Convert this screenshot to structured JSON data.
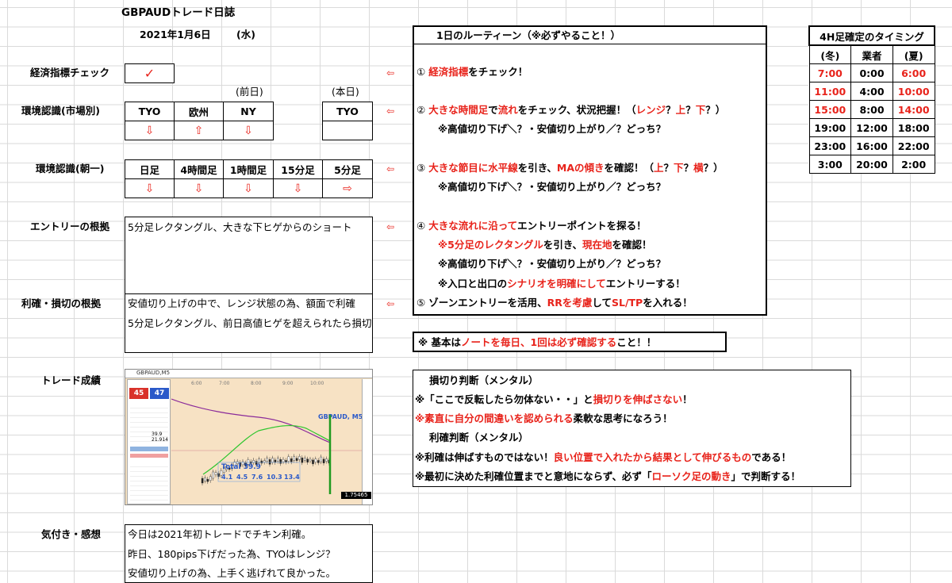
{
  "header": {
    "title": "GBPAUDトレード日誌",
    "date": "2021年1月6日",
    "weekday": "(水)"
  },
  "labels": {
    "indicator_check": "経済指標チェック",
    "env_market": "環境認識(市場別)",
    "env_morning": "環境認識(朝一)",
    "entry_basis": "エントリーの根拠",
    "tp_sl_basis": "利確・損切の根拠",
    "result": "トレード成績",
    "notes": "気付き・感想"
  },
  "indicator_check": {
    "mark": "✓"
  },
  "market_env": {
    "prev_day": "(前日)",
    "today": "(本日)",
    "cols": [
      "TYO",
      "欧州",
      "NY"
    ],
    "arrows": [
      "⇩",
      "⇧",
      "⇩"
    ],
    "today_col": "TYO"
  },
  "morning_env": {
    "cols": [
      "日足",
      "4時間足",
      "1時間足",
      "15分足",
      "5分足"
    ],
    "arrows": [
      "⇩",
      "⇩",
      "⇩",
      "⇩",
      "⇨"
    ]
  },
  "entry": {
    "text": "5分足レクタングル、大きな下ヒゲからのショート"
  },
  "tpsl": {
    "line1": "安値切り上げの中で、レンジ状態の為、額面で利確",
    "line2": "5分足レクタングル、前日高値ヒゲを超えられたら損切"
  },
  "notes": {
    "line1": "今日は2021年初トレードでチキン利確。",
    "line2": "昨日、180pips下げだった為、TYOはレンジ？",
    "line3": "安値切り上げの為、上手く逃げれて良かった。"
  },
  "left_arrow": "⇦",
  "routine": {
    "title": "1日のルーティーン（※必ずやること！）",
    "r1_num": "①",
    "r1_a": "経済指標",
    "r1_b": "をチェック！",
    "r2_num": "②",
    "r2_a": "大きな時間足",
    "r2_b": "で",
    "r2_c": "流れ",
    "r2_d": "をチェック、状況把握！（",
    "r2_e": "レンジ",
    "r2_f": "？",
    "r2_g": "上",
    "r2_h": "？",
    "r2_i": "下",
    "r2_j": "？）",
    "r2_sub": "※高値切り下げ＼？・安値切り上がり／？どっち？",
    "r3_num": "③",
    "r3_a": "大きな節目に",
    "r3_b": "水平線",
    "r3_c": "を引き、",
    "r3_d": "MAの傾き",
    "r3_e": "を確認！（",
    "r3_f": "上",
    "r3_g": "？",
    "r3_h": "下",
    "r3_i": "？",
    "r3_j": "横",
    "r3_k": "？）",
    "r3_sub": "※高値切り下げ＼？・安値切り上がり／？どっち？",
    "r4_num": "④",
    "r4_a": "大きな流れに沿って",
    "r4_b": "エントリーポイントを探る！",
    "r4_s1a": "※5分足のレクタングル",
    "r4_s1b": "を引き、",
    "r4_s1c": "現在地",
    "r4_s1d": "を確認！",
    "r4_s2": "※高値切り下げ＼？・安値切り上がり／？どっち？",
    "r4_s3a": "※入口と出口の",
    "r4_s3b": "シナリオを明確にして",
    "r4_s3c": "エントリーする！",
    "r5_num": "⑤",
    "r5_a": "ゾーンエントリーを活用、",
    "r5_b": "RRを考慮",
    "r5_c": "して",
    "r5_d": "SL/TP",
    "r5_e": "を入れる！"
  },
  "note_box": {
    "a": "※ 基本は",
    "b": "ノートを毎日、1回は必ず確認する",
    "c": "こと！！"
  },
  "mental": {
    "sl_title": "損切り判断（メンタル）",
    "sl1_a": "※「ここで反転したら勿体ない・・」と",
    "sl1_b": "損切りを伸ばさない",
    "sl1_c": "！",
    "sl2_a": "※素直に自分の間違いを認められる",
    "sl2_b": "柔軟な思考になろう！",
    "tp_title": "利確判断（メンタル）",
    "tp1_a": "※利確は伸ばすものではない！",
    "tp1_b": "良い位置で入れたから結果として伸びるもの",
    "tp1_c": "である！",
    "tp2_a": "※最初に決めた利確位置までと意地にならず、必ず「",
    "tp2_b": "ローソク足の動き",
    "tp2_c": "」で判断する！"
  },
  "timing": {
    "title": "4H足確定のタイミング",
    "headers": [
      "(冬)",
      "業者",
      "(夏)"
    ],
    "rows": [
      [
        "7:00",
        "0:00",
        "6:00"
      ],
      [
        "11:00",
        "4:00",
        "10:00"
      ],
      [
        "15:00",
        "8:00",
        "14:00"
      ],
      [
        "19:00",
        "12:00",
        "18:00"
      ],
      [
        "23:00",
        "16:00",
        "22:00"
      ],
      [
        "3:00",
        "20:00",
        "2:00"
      ]
    ],
    "red_rows": 3
  },
  "chart": {
    "window_title": "GBPAUD,M5",
    "symbol_label": "GBPAUD, M5",
    "total_label": "Total 39.9",
    "trades": [
      "4.1",
      "4.5",
      "7.6",
      "10.3",
      "13.4"
    ],
    "panel_values": [
      "39.9",
      "21.914"
    ],
    "price_tag": "1.75465",
    "time_labels": [
      "6:00",
      "7:00",
      "8:00",
      "9:00",
      "10:00"
    ],
    "sell_price": "45",
    "buy_price": "47"
  }
}
